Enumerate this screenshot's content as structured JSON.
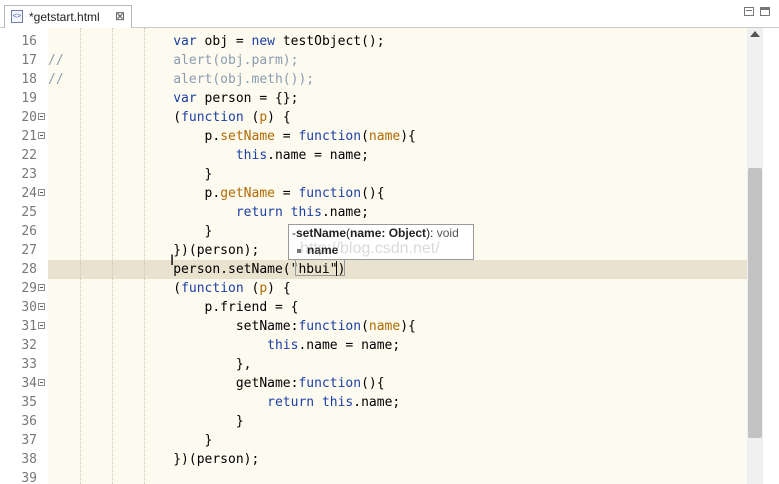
{
  "tab": {
    "title": "*getstart.html",
    "icon": "html-file-icon",
    "close_glyph": "⊠"
  },
  "editor": {
    "current_line": "28",
    "lines": [
      {
        "num": "16",
        "fold": false,
        "segs": [
          [
            "",
            "                "
          ],
          [
            "kw",
            "var"
          ],
          [
            "",
            " obj = "
          ],
          [
            "kw",
            "new"
          ],
          [
            "",
            " testObject();"
          ]
        ]
      },
      {
        "num": "17",
        "fold": false,
        "segs": [
          [
            "cm",
            "//              alert(obj.parm);"
          ]
        ]
      },
      {
        "num": "18",
        "fold": false,
        "segs": [
          [
            "cm",
            "//              alert(obj.meth());"
          ]
        ]
      },
      {
        "num": "19",
        "fold": false,
        "segs": [
          [
            "",
            "                "
          ],
          [
            "kw",
            "var"
          ],
          [
            "",
            " person = {};"
          ]
        ]
      },
      {
        "num": "20",
        "fold": true,
        "segs": [
          [
            "",
            "                ("
          ],
          [
            "kw",
            "function"
          ],
          [
            "",
            " ("
          ],
          [
            "fn",
            "p"
          ],
          [
            "",
            ") {"
          ]
        ]
      },
      {
        "num": "21",
        "fold": true,
        "segs": [
          [
            "",
            "                    p."
          ],
          [
            "fn",
            "setName"
          ],
          [
            "",
            " = "
          ],
          [
            "kw",
            "function"
          ],
          [
            "",
            "("
          ],
          [
            "fn",
            "name"
          ],
          [
            "",
            "){"
          ]
        ]
      },
      {
        "num": "22",
        "fold": false,
        "segs": [
          [
            "",
            "                        "
          ],
          [
            "kw",
            "this"
          ],
          [
            "",
            ".name = name;"
          ]
        ]
      },
      {
        "num": "23",
        "fold": false,
        "segs": [
          [
            "",
            "                    }"
          ]
        ]
      },
      {
        "num": "24",
        "fold": true,
        "segs": [
          [
            "",
            "                    p."
          ],
          [
            "fn",
            "getName"
          ],
          [
            "",
            " = "
          ],
          [
            "kw",
            "function"
          ],
          [
            "",
            "(){"
          ]
        ]
      },
      {
        "num": "25",
        "fold": false,
        "segs": [
          [
            "",
            "                        "
          ],
          [
            "kw",
            "return"
          ],
          [
            "",
            " "
          ],
          [
            "kw",
            "this"
          ],
          [
            "",
            ".name;"
          ]
        ]
      },
      {
        "num": "26",
        "fold": false,
        "segs": [
          [
            "",
            "                    }"
          ]
        ]
      },
      {
        "num": "27",
        "fold": false,
        "segs": [
          [
            "",
            "                })(person);"
          ]
        ]
      },
      {
        "num": "28",
        "fold": false,
        "segs": [
          [
            "",
            "                person.setName(\"hbui\")"
          ]
        ]
      },
      {
        "num": "29",
        "fold": true,
        "segs": [
          [
            "",
            "                ("
          ],
          [
            "kw",
            "function"
          ],
          [
            "",
            " ("
          ],
          [
            "fn",
            "p"
          ],
          [
            "",
            ") {"
          ]
        ]
      },
      {
        "num": "30",
        "fold": true,
        "segs": [
          [
            "",
            "                    p.friend = {"
          ]
        ]
      },
      {
        "num": "31",
        "fold": true,
        "segs": [
          [
            "",
            "                        setName:"
          ],
          [
            "kw",
            "function"
          ],
          [
            "",
            "("
          ],
          [
            "fn",
            "name"
          ],
          [
            "",
            "){"
          ]
        ]
      },
      {
        "num": "32",
        "fold": false,
        "segs": [
          [
            "",
            "                            "
          ],
          [
            "kw",
            "this"
          ],
          [
            "",
            ".name = name;"
          ]
        ]
      },
      {
        "num": "33",
        "fold": false,
        "segs": [
          [
            "",
            "                        },"
          ]
        ]
      },
      {
        "num": "34",
        "fold": true,
        "segs": [
          [
            "",
            "                        getName:"
          ],
          [
            "kw",
            "function"
          ],
          [
            "",
            "(){"
          ]
        ]
      },
      {
        "num": "35",
        "fold": false,
        "segs": [
          [
            "",
            "                            "
          ],
          [
            "kw",
            "return"
          ],
          [
            "",
            " "
          ],
          [
            "kw",
            "this"
          ],
          [
            "",
            ".name;"
          ]
        ]
      },
      {
        "num": "36",
        "fold": false,
        "segs": [
          [
            "",
            "                        }"
          ]
        ]
      },
      {
        "num": "37",
        "fold": false,
        "segs": [
          [
            "",
            "                    }"
          ]
        ]
      },
      {
        "num": "38",
        "fold": false,
        "segs": [
          [
            "",
            "                })(person);"
          ]
        ]
      },
      {
        "num": "39",
        "fold": false,
        "segs": [
          [
            "",
            ""
          ]
        ]
      }
    ]
  },
  "popup": {
    "sig_prefix": "-",
    "method": "setName",
    "open": "(",
    "param_sig": "name: Object",
    "close": "): ",
    "return_type": "void",
    "param_name": "name"
  },
  "watermark": "http://blog.csdn.net/",
  "colors": {
    "keyword": "#1b3fa6",
    "identifier": "#b36900",
    "comment": "#8a9cb0",
    "editor_bg": "#fdfbf0",
    "current_line_bg": "#e8e2cf"
  }
}
